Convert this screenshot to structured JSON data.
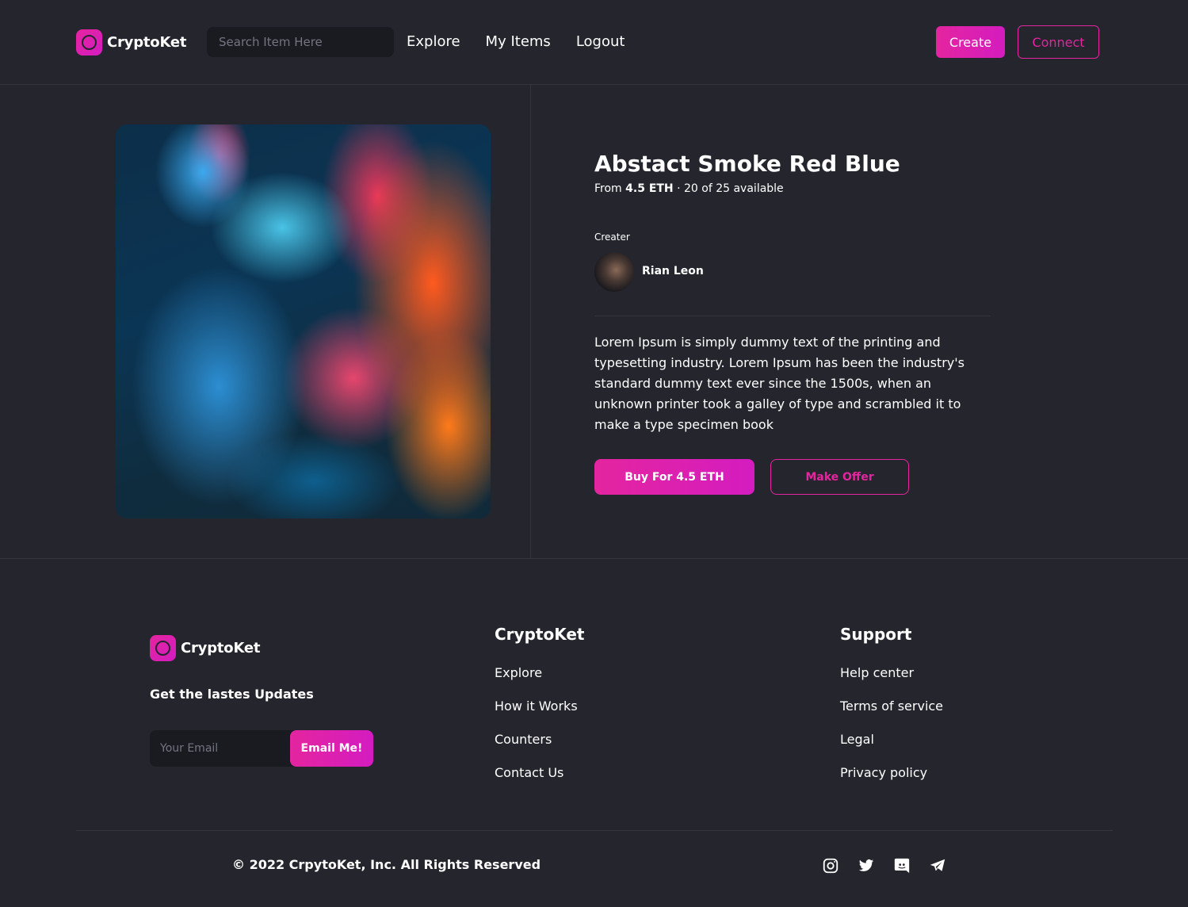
{
  "brand": {
    "name": "CryptoKet",
    "accent": "#e4259f"
  },
  "header": {
    "search_placeholder": "Search Item Here",
    "nav": [
      "Explore",
      "My Items",
      "Logout"
    ],
    "create_label": "Create",
    "connect_label": "Connect"
  },
  "item": {
    "title": "Abstact Smoke Red Blue",
    "price_prefix": "From ",
    "price": "4.5 ETH",
    "availability": " · 20 of 25 available",
    "creator_label": "Creater",
    "creator_name": "Rian Leon",
    "description": "Lorem Ipsum is simply dummy text of the printing and typesetting industry. Lorem Ipsum has been the industry's standard dummy text ever since the 1500s, when an unknown printer took a galley of type and scrambled it to make a type specimen book",
    "buy_label": "Buy For 4.5 ETH",
    "offer_label": "Make Offer"
  },
  "footer": {
    "brand": "CryptoKet",
    "updates_heading": "Get the lastes Updates",
    "email_placeholder": "Your Email",
    "email_button": "Email Me!",
    "col1": {
      "title": "CryptoKet",
      "links": [
        "Explore",
        "How it Works",
        "Counters",
        "Contact Us"
      ]
    },
    "col2": {
      "title": "Support",
      "links": [
        "Help center",
        "Terms of service",
        "Legal",
        "Privacy policy"
      ]
    },
    "copyright": "© 2022 CrpytoKet, Inc. All Rights Reserved",
    "socials": [
      "instagram-icon",
      "twitter-icon",
      "discord-icon",
      "telegram-icon"
    ]
  }
}
